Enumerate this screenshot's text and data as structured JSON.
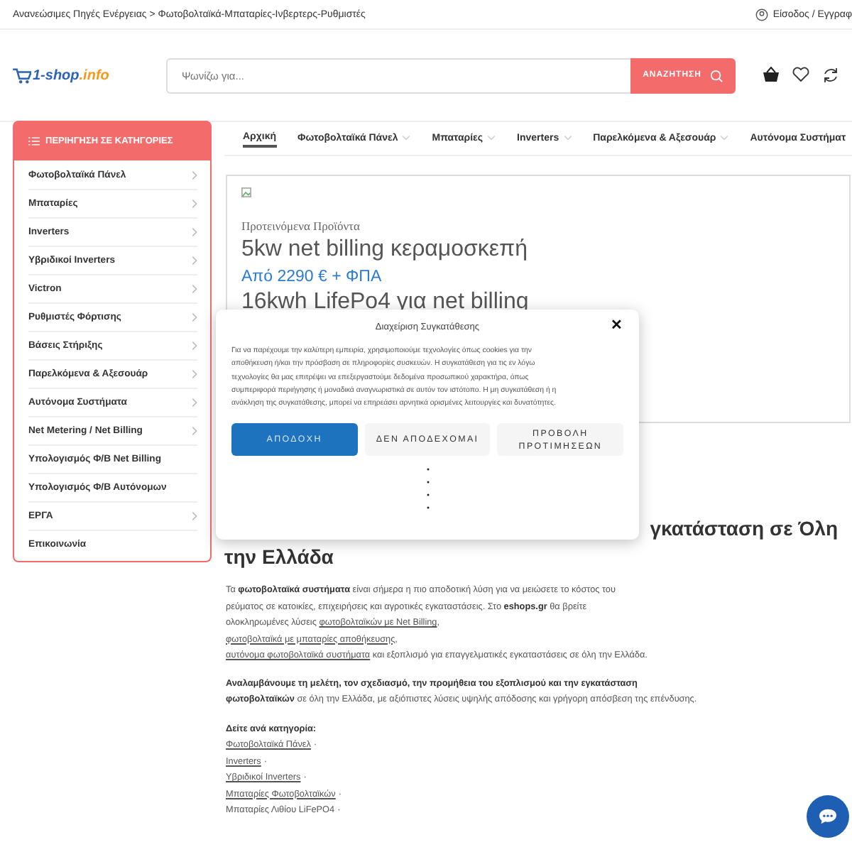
{
  "breadcrumb": "Ανανεώσιμες Πηγές Ενέργειας > Φωτοβολταϊκά-Μπαταρίες-Ινβερτερς-Ρυθμιστές",
  "account_link": "Είσοδος / Εγγραφ",
  "logo": {
    "main": "1-shop",
    "suffix": ".info"
  },
  "search": {
    "placeholder": "Ψωνίζω για...",
    "button": "ΑΝΑΖΗΤΗΣΗ"
  },
  "categories_header": "ΠΕΡΙΗΓΗΣΗ ΣΕ ΚΑΤΗΓΟΡΙΕΣ",
  "sidebar": {
    "items": [
      {
        "label": "Φωτοβολταϊκά Πάνελ",
        "has_submenu": true
      },
      {
        "label": "Μπαταρίες",
        "has_submenu": true
      },
      {
        "label": "Inverters",
        "has_submenu": true
      },
      {
        "label": "Υβριδικοί Inverters",
        "has_submenu": true
      },
      {
        "label": "Victron",
        "has_submenu": true
      },
      {
        "label": "Ρυθμιστές Φόρτισης",
        "has_submenu": true
      },
      {
        "label": "Βάσεις Στήριξης",
        "has_submenu": true
      },
      {
        "label": "Παρελκόμενα & Αξεσουάρ",
        "has_submenu": true
      },
      {
        "label": "Αυτόνομα Συστήματα",
        "has_submenu": true
      },
      {
        "label": "Net Metering / Net Billing",
        "has_submenu": true
      },
      {
        "label": "Υπολογισμός Φ/Β Net Billing",
        "has_submenu": false
      },
      {
        "label": "Υπολογισμός Φ/Β Αυτόνομων",
        "has_submenu": false
      },
      {
        "label": "ΕΡΓΑ",
        "has_submenu": true
      },
      {
        "label": "Επικοινωνία",
        "has_submenu": false
      }
    ]
  },
  "nav": [
    {
      "label": "Αρχική",
      "selected": true,
      "has_dropdown": false
    },
    {
      "label": "Φωτοβολταϊκά Πάνελ",
      "selected": false,
      "has_dropdown": true
    },
    {
      "label": "Μπαταρίες",
      "selected": false,
      "has_dropdown": true
    },
    {
      "label": "Inverters",
      "selected": false,
      "has_dropdown": true
    },
    {
      "label": "Παρελκόμενα & Αξεσουάρ",
      "selected": false,
      "has_dropdown": true
    },
    {
      "label": "Αυτόνομα Συστήματ",
      "selected": false,
      "has_dropdown": false
    }
  ],
  "banner": {
    "kicker": "Προτεινόμενα Προϊόντα",
    "title": "5kw net billing κεραμοσκεπή",
    "price": "Από 2290 € + ΦΠΑ",
    "subtitle": "16kwh LifePo4 για net billing"
  },
  "heading": {
    "line_1": "γκατάσταση σε Όλη",
    "line_2": "την Ελλάδα"
  },
  "paragraphs": [
    [
      {
        "kind": "text",
        "text": "Τα "
      },
      {
        "kind": "bold",
        "text": "φωτοβολταϊκά συστήματα"
      },
      {
        "kind": "text",
        "text": " είναι σήμερα η πιο αποδοτική λύση για να μειώσετε το κόστος του ρεύματος σε κατοικίες, επιχειρήσεις και αγροτικές εγκαταστάσεις. Στο "
      },
      {
        "kind": "bold",
        "text": "eshops.gr"
      },
      {
        "kind": "text",
        "text": " θα βρείτε ολοκληρωμένες λύσεις "
      },
      {
        "kind": "link",
        "text": "φωτοβολταϊκών με Net Billing"
      },
      {
        "kind": "text",
        "text": ","
      },
      {
        "kind": "break"
      },
      {
        "kind": "link",
        "text": "φωτοβολταϊκά με μπαταρίες αποθήκευσης"
      },
      {
        "kind": "text",
        "text": ","
      },
      {
        "kind": "break"
      },
      {
        "kind": "link",
        "text": "αυτόνομα φωτοβολταϊκά συστήματα"
      },
      {
        "kind": "text",
        "text": " και εξοπλισμό για επαγγελματικές εγκαταστάσεις σε όλη την Ελλάδα."
      }
    ],
    [
      {
        "kind": "bold",
        "text": "Αναλαμβάνουμε τη μελέτη, τον σχεδιασμό, την προμήθεια του εξοπλισμού και την εγκατάσταση φωτοβολταϊκών"
      },
      {
        "kind": "text",
        "text": " σε όλη την Ελλάδα, με αξιόπιστες λύσεις υψηλής απόδοσης και γρήγορη απόσβεση της επένδυσης."
      }
    ]
  ],
  "category_links": {
    "title": "Δείτε ανά κατηγορία:",
    "items": [
      {
        "label": "Φωτοβολταϊκά Πάνελ",
        "separator": "·",
        "underlined": true
      },
      {
        "label": "Inverters",
        "separator": "·",
        "underlined": true
      },
      {
        "label": "Υβριδικοί Inverters",
        "separator": "·",
        "underlined": true
      },
      {
        "label": "Μπαταρίες Φωτοβολταϊκών",
        "separator": "·",
        "underlined": true
      },
      {
        "label": "Μπαταρίες Λιθίου LiFePO4",
        "separator": "·",
        "underlined": false
      }
    ]
  },
  "consent": {
    "title": "Διαχείριση Συγκατάθεσης",
    "close": "✕",
    "text": "Για να παρέχουμε την καλύτερη εμπειρία, χρησιμοποιούμε τεχνολογίες όπως cookies για την αποθήκευση ή/και την πρόσβαση σε πληροφορίες συσκευών. Η συγκατάθεση για τις εν λόγω τεχνολογίες θα μας επιτρέψει να επεξεργαστούμε δεδομένα προσωπικού χαρακτήρα, όπως συμπεριφορά περιήγησης ή μοναδικά αναγνωριστικά σε αυτόν τον ιστότοπο. Η μη συγκατάθεση ή η ανάκληση της συγκατάθεσης, μπορεί να επηρεάσει αρνητικά ορισμένες λειτουργίες και δυνατότητες.",
    "buttons": [
      {
        "label": "ΑΠΟΔΟΧΗ",
        "kind": "primary"
      },
      {
        "label": "ΔΕΝ ΑΠΟΔΕΧΟΜΑΙ",
        "kind": "secondary"
      },
      {
        "label": "ΠΡΟΒΟΛΗ ΠΡΟΤΙΜΗΣΕΩΝ",
        "kind": "secondary"
      }
    ]
  }
}
